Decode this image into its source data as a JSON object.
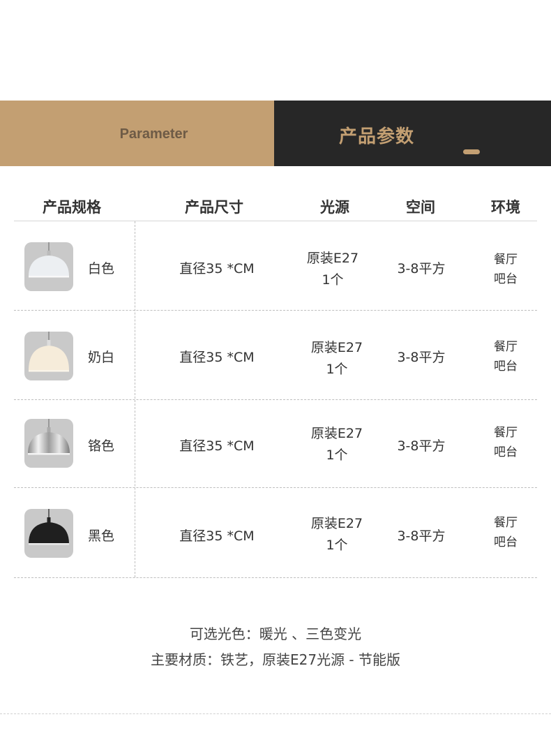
{
  "banner": {
    "left_text": "Parameter",
    "right_text": "产品参数",
    "colors": {
      "left_bg": "#c39f72",
      "right_bg": "#272727",
      "accent": "#c39f72"
    }
  },
  "table": {
    "headers": [
      "产品规格",
      "产品尺寸",
      "光源",
      "空间",
      "环境"
    ],
    "rows": [
      {
        "lamp": "white-pendant-lamp",
        "color": "白色",
        "size": "直径35 *CM",
        "source_line1": "原装E27",
        "source_line2": "1个",
        "space": "3-8平方",
        "env_line1": "餐厅",
        "env_line2": "吧台"
      },
      {
        "lamp": "milky-white-pendant-lamp",
        "color": "奶白",
        "size": "直径35 *CM",
        "source_line1": "原装E27",
        "source_line2": "1个",
        "space": "3-8平方",
        "env_line1": "餐厅",
        "env_line2": "吧台"
      },
      {
        "lamp": "chrome-pendant-lamp",
        "color": "铬色",
        "size": "直径35 *CM",
        "source_line1": "原装E27",
        "source_line2": "1个",
        "space": "3-8平方",
        "env_line1": "餐厅",
        "env_line2": "吧台"
      },
      {
        "lamp": "black-pendant-lamp",
        "color": "黑色",
        "size": "直径35 *CM",
        "source_line1": "原装E27",
        "source_line2": "1个",
        "space": "3-8平方",
        "env_line1": "餐厅",
        "env_line2": "吧台"
      }
    ]
  },
  "notes": {
    "line1": "可选光色：暖光 、三色变光",
    "line2": "主要材质：铁艺，原装E27光源 - 节能版"
  }
}
